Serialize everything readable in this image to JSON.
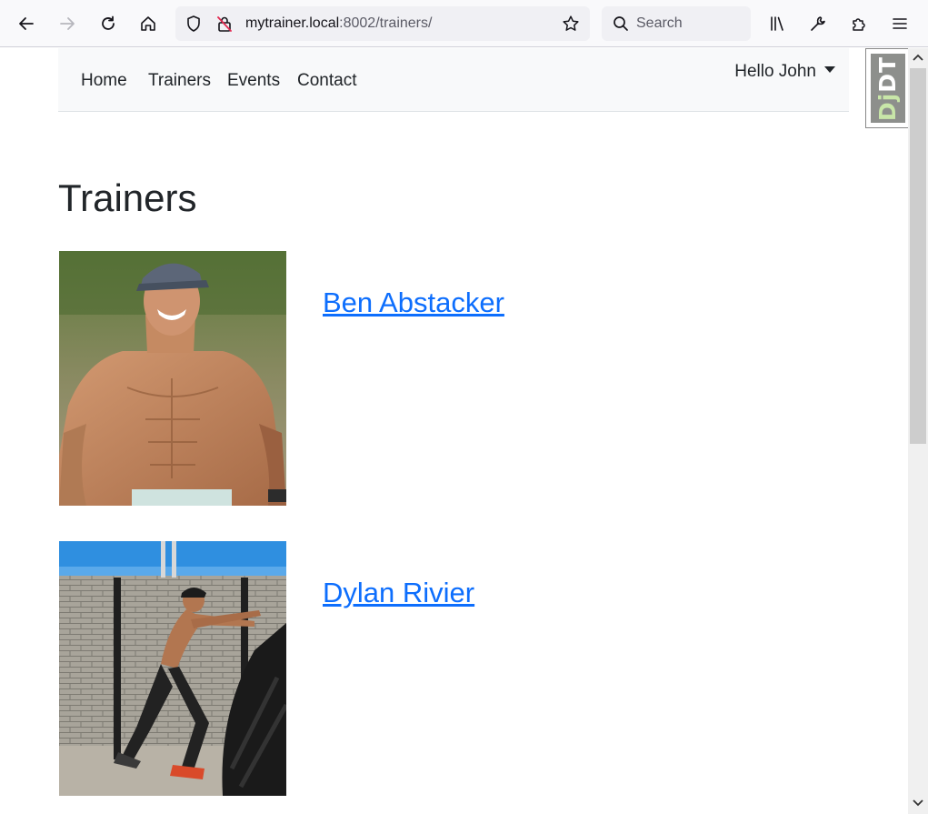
{
  "browser": {
    "url_host": "mytrainer.local",
    "url_rest": ":8002/trainers/",
    "search_placeholder": "Search"
  },
  "navbar": {
    "links": [
      "Home",
      "Trainers",
      "Events",
      "Contact"
    ],
    "user_greeting": "Hello John"
  },
  "debug_toolbar": {
    "label_dj": "Dj",
    "label_dt": "DT"
  },
  "page": {
    "title": "Trainers"
  },
  "trainers": [
    {
      "name": "Ben Abstacker"
    },
    {
      "name": "Dylan Rivier"
    }
  ],
  "colors": {
    "link": "#0d6efd",
    "navbar_bg": "#f8f9fa",
    "toolbar_bg": "#f9f9fb"
  }
}
